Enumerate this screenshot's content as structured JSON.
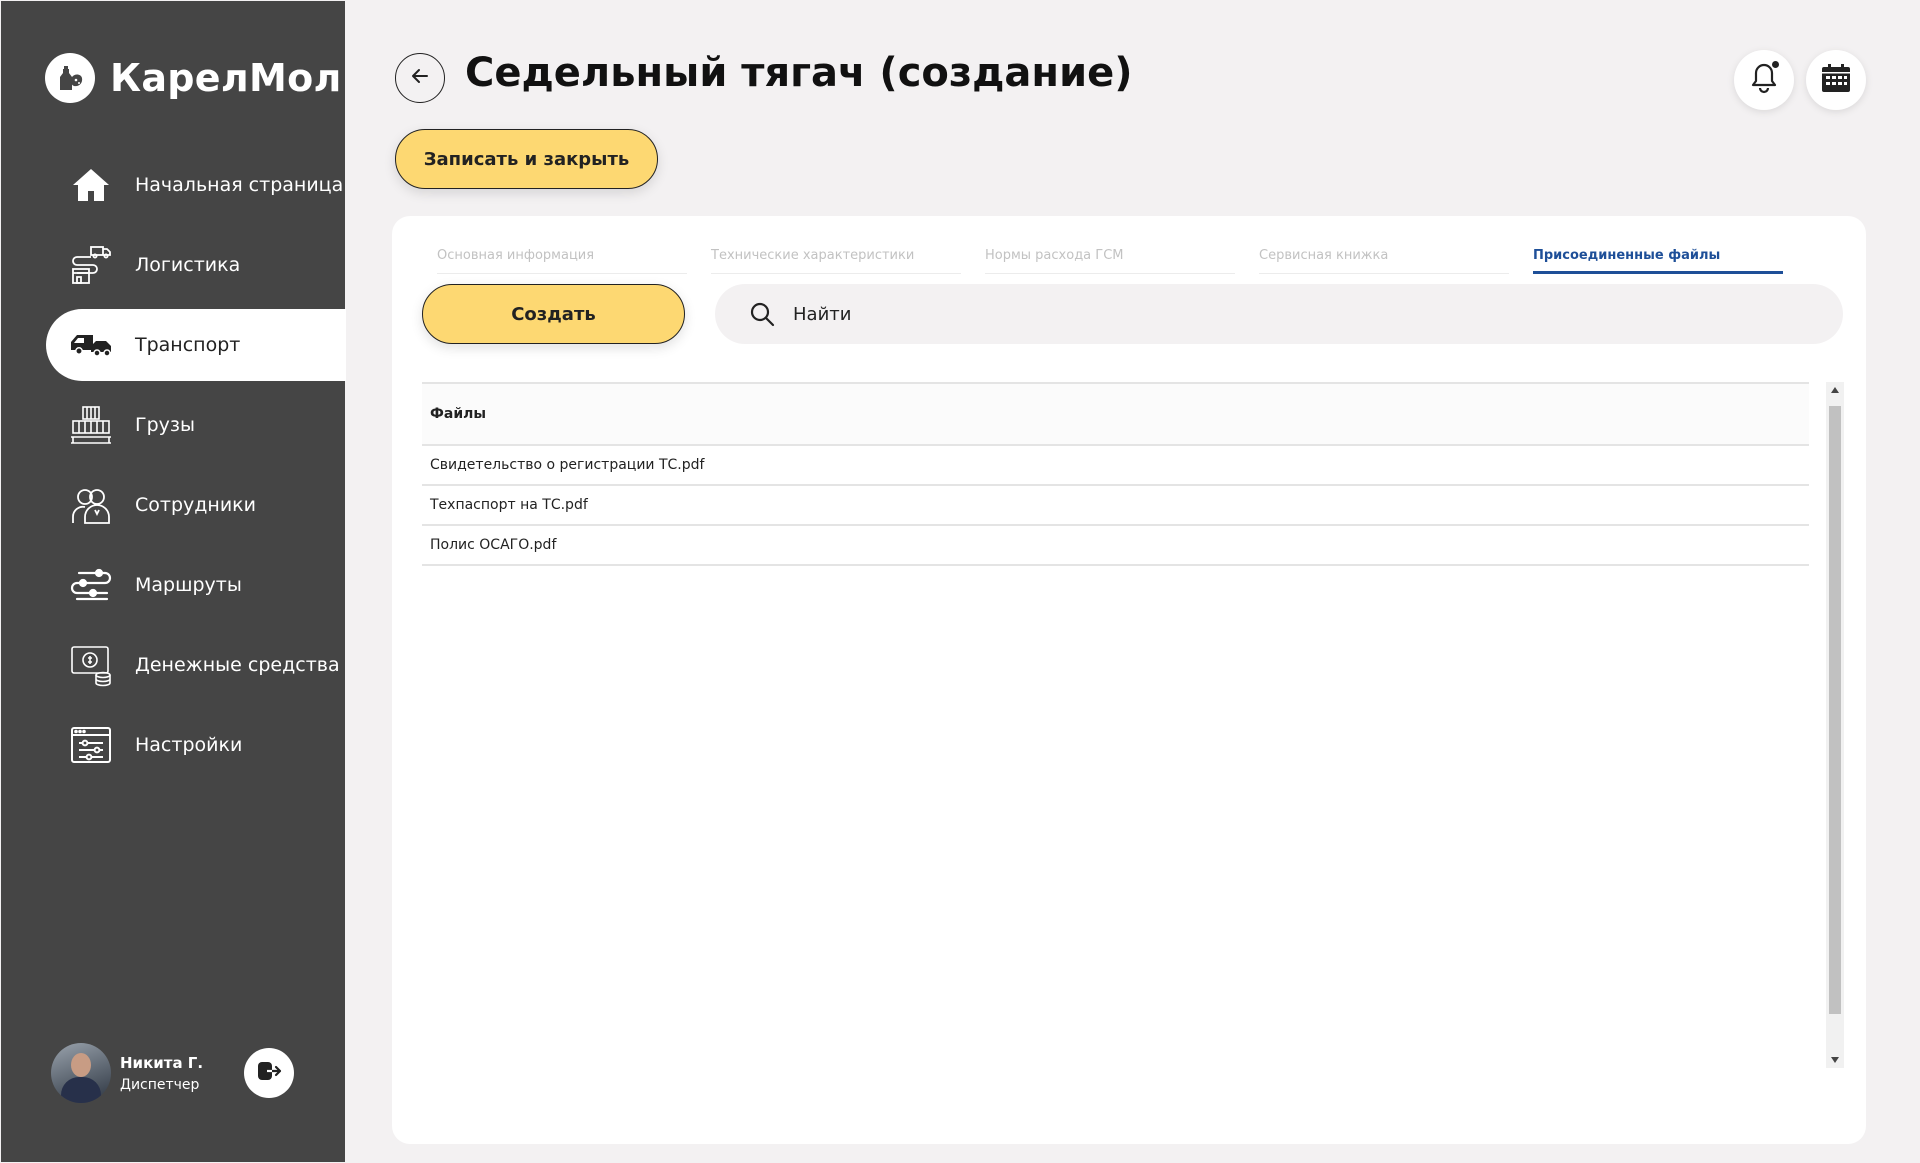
{
  "brand": {
    "name": "КарелМол",
    "logo_icon": "milk-bottle-logo-icon"
  },
  "sidebar": {
    "items": [
      {
        "label": "Начальная страница",
        "icon": "home-icon",
        "active": false
      },
      {
        "label": "Логистика",
        "icon": "logistics-icon",
        "active": false
      },
      {
        "label": "Транспорт",
        "icon": "transport-icon",
        "active": true
      },
      {
        "label": "Грузы",
        "icon": "cargo-icon",
        "active": false
      },
      {
        "label": "Сотрудники",
        "icon": "employees-icon",
        "active": false
      },
      {
        "label": "Маршруты",
        "icon": "routes-icon",
        "active": false
      },
      {
        "label": "Денежные средства",
        "icon": "money-icon",
        "active": false
      },
      {
        "label": "Настройки",
        "icon": "settings-icon",
        "active": false
      }
    ]
  },
  "user": {
    "name": "Никита Г.",
    "role": "Диспетчер"
  },
  "header": {
    "title": "Седельный тягач (создание)",
    "save_close_label": "Записать и закрыть"
  },
  "tabs": [
    {
      "label": "Основная информация",
      "active": false
    },
    {
      "label": "Технические характеристики",
      "active": false
    },
    {
      "label": "Нормы расхода ГСМ",
      "active": false
    },
    {
      "label": "Сервисная книжка",
      "active": false
    },
    {
      "label": "Присоединенные файлы",
      "active": true
    }
  ],
  "toolbar": {
    "create_label": "Создать"
  },
  "search": {
    "placeholder": "Найти"
  },
  "table": {
    "header": "Файлы",
    "rows": [
      "Свидетельство о регистрации ТС.pdf",
      "Техпаспорт на ТС.pdf",
      "Полис ОСАГО.pdf"
    ]
  },
  "colors": {
    "sidebar_bg": "#454545",
    "accent_yellow": "#fdd872",
    "active_tab": "#1e4f98",
    "page_bg": "#f3f1f2"
  }
}
